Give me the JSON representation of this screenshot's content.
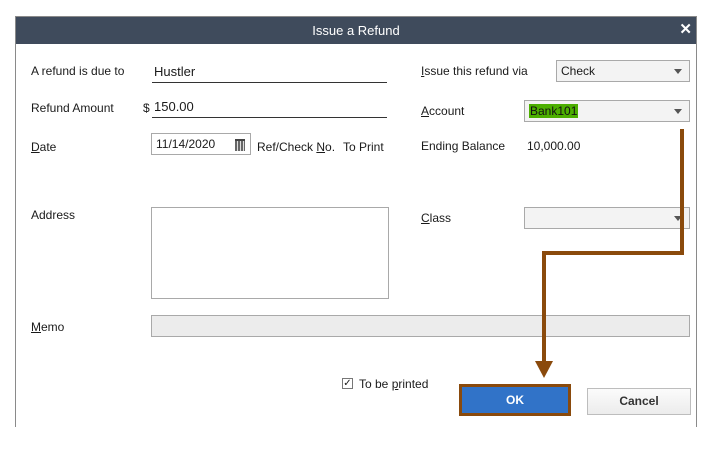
{
  "window": {
    "title": "Issue a Refund"
  },
  "form": {
    "due_to_label": "A refund is due to",
    "due_to_value": "Hustler",
    "amount_label": "Refund Amount",
    "currency_symbol": "$",
    "amount_value": "150.00",
    "date_label_u": "D",
    "date_label_rest": "ate",
    "date_value": "11/14/2020",
    "refcheck_label_pre": "Ref/Check ",
    "refcheck_label_u": "N",
    "refcheck_label_post": "o.",
    "refcheck_value": "To Print",
    "address_label": "Address",
    "memo_label_u": "M",
    "memo_label_rest": "emo",
    "issue_via_label_pre": "I",
    "issue_via_label_rest": "ssue this refund via",
    "issue_via_value": "Check",
    "account_label_u": "A",
    "account_label_rest": "ccount",
    "account_value": "Bank101",
    "ending_balance_label": "Ending Balance",
    "ending_balance_value": "10,000.00",
    "class_label_u": "C",
    "class_label_rest": "lass",
    "to_be_printed_pre": "To be ",
    "to_be_printed_u": "p",
    "to_be_printed_post": "rinted",
    "to_be_printed_checked": true
  },
  "buttons": {
    "ok": "OK",
    "cancel": "Cancel"
  },
  "icons": {
    "close": "close-icon",
    "calendar": "calendar-icon",
    "dropdown": "chevron-down-icon",
    "checkmark": "check-icon"
  },
  "colors": {
    "titlebar": "#3f4b5c",
    "ok_button": "#3173c8",
    "annotation": "#8a4a0c",
    "selection": "#4caf00"
  }
}
